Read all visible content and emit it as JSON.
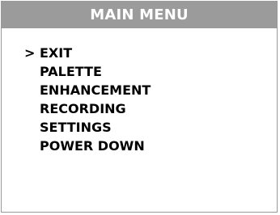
{
  "menu": {
    "title": "MAIN MENU",
    "cursor": ">",
    "selected_index": 0,
    "items": [
      {
        "label": "EXIT"
      },
      {
        "label": "PALETTE"
      },
      {
        "label": "ENHANCEMENT"
      },
      {
        "label": "RECORDING"
      },
      {
        "label": "SETTINGS"
      },
      {
        "label": "POWER DOWN"
      }
    ]
  },
  "colors": {
    "header_background": "#9b9b9b",
    "header_text": "#ffffff",
    "item_text": "#000000",
    "frame_border": "#9a9a9a"
  }
}
